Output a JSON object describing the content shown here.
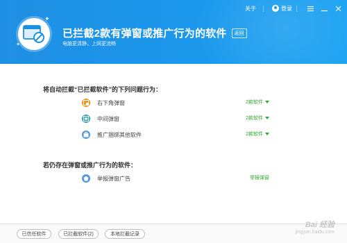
{
  "topbar": {
    "about": "关于",
    "login": "登录"
  },
  "header": {
    "title": "已拦截2款有弹窗或推广行为的软件",
    "back": "返回",
    "subtitle": "电脑更清静，上网更流畅"
  },
  "section1": {
    "title": "将自动拦截“已拦截软件”的下列问题行为：",
    "items": [
      {
        "label": "右下角弹窗",
        "status": "2款软件",
        "icon": "popup-corner-icon",
        "color": "#f2931f"
      },
      {
        "label": "中间弹窗",
        "status": "2款软件",
        "icon": "popup-center-icon",
        "color": "#2aa6b8"
      },
      {
        "label": "推广捆绑其他软件",
        "status": "2款软件",
        "icon": "bundle-icon",
        "color": "#4f97e8"
      }
    ]
  },
  "section2": {
    "title": "若仍存在弹窗或推广行为的软件：",
    "items": [
      {
        "label": "举报弹窗广告",
        "action": "举报弹窗",
        "icon": "report-icon",
        "color": "#4f97e8"
      }
    ]
  },
  "footer": {
    "trusted": "已信任软件",
    "blocked": "已拦截软件(2)",
    "records": "本地拦截记录"
  },
  "watermark": {
    "main": "Bai 经验",
    "sub": "jingyan.baidu.com"
  }
}
